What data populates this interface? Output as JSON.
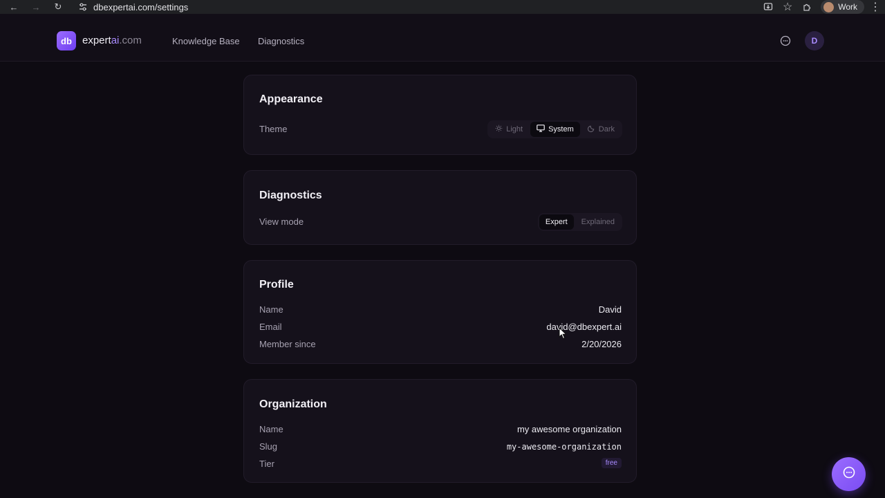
{
  "browser": {
    "url": "dbexpertai.com/settings",
    "profile_label": "Work"
  },
  "header": {
    "logo_text": "db",
    "brand_main": "expert",
    "brand_ai": "ai",
    "brand_domain": ".com",
    "nav": [
      "Knowledge Base",
      "Diagnostics"
    ],
    "avatar_initial": "D"
  },
  "appearance": {
    "title": "Appearance",
    "theme_label": "Theme",
    "options": [
      "Light",
      "System",
      "Dark"
    ],
    "selected": "System"
  },
  "diagnostics": {
    "title": "Diagnostics",
    "view_mode_label": "View mode",
    "options": [
      "Expert",
      "Explained"
    ],
    "selected": "Expert"
  },
  "profile": {
    "title": "Profile",
    "name_label": "Name",
    "name_value": "David",
    "email_label": "Email",
    "email_value": "david@dbexpert.ai",
    "member_label": "Member since",
    "member_value": "2/20/2026"
  },
  "organization": {
    "title": "Organization",
    "name_label": "Name",
    "name_value": "my awesome organization",
    "slug_label": "Slug",
    "slug_value": "my-awesome-organization",
    "tier_label": "Tier",
    "tier_value": "free"
  },
  "colors": {
    "accent": "#9b6cff",
    "background": "#0e0b12",
    "card": "#15111b"
  }
}
